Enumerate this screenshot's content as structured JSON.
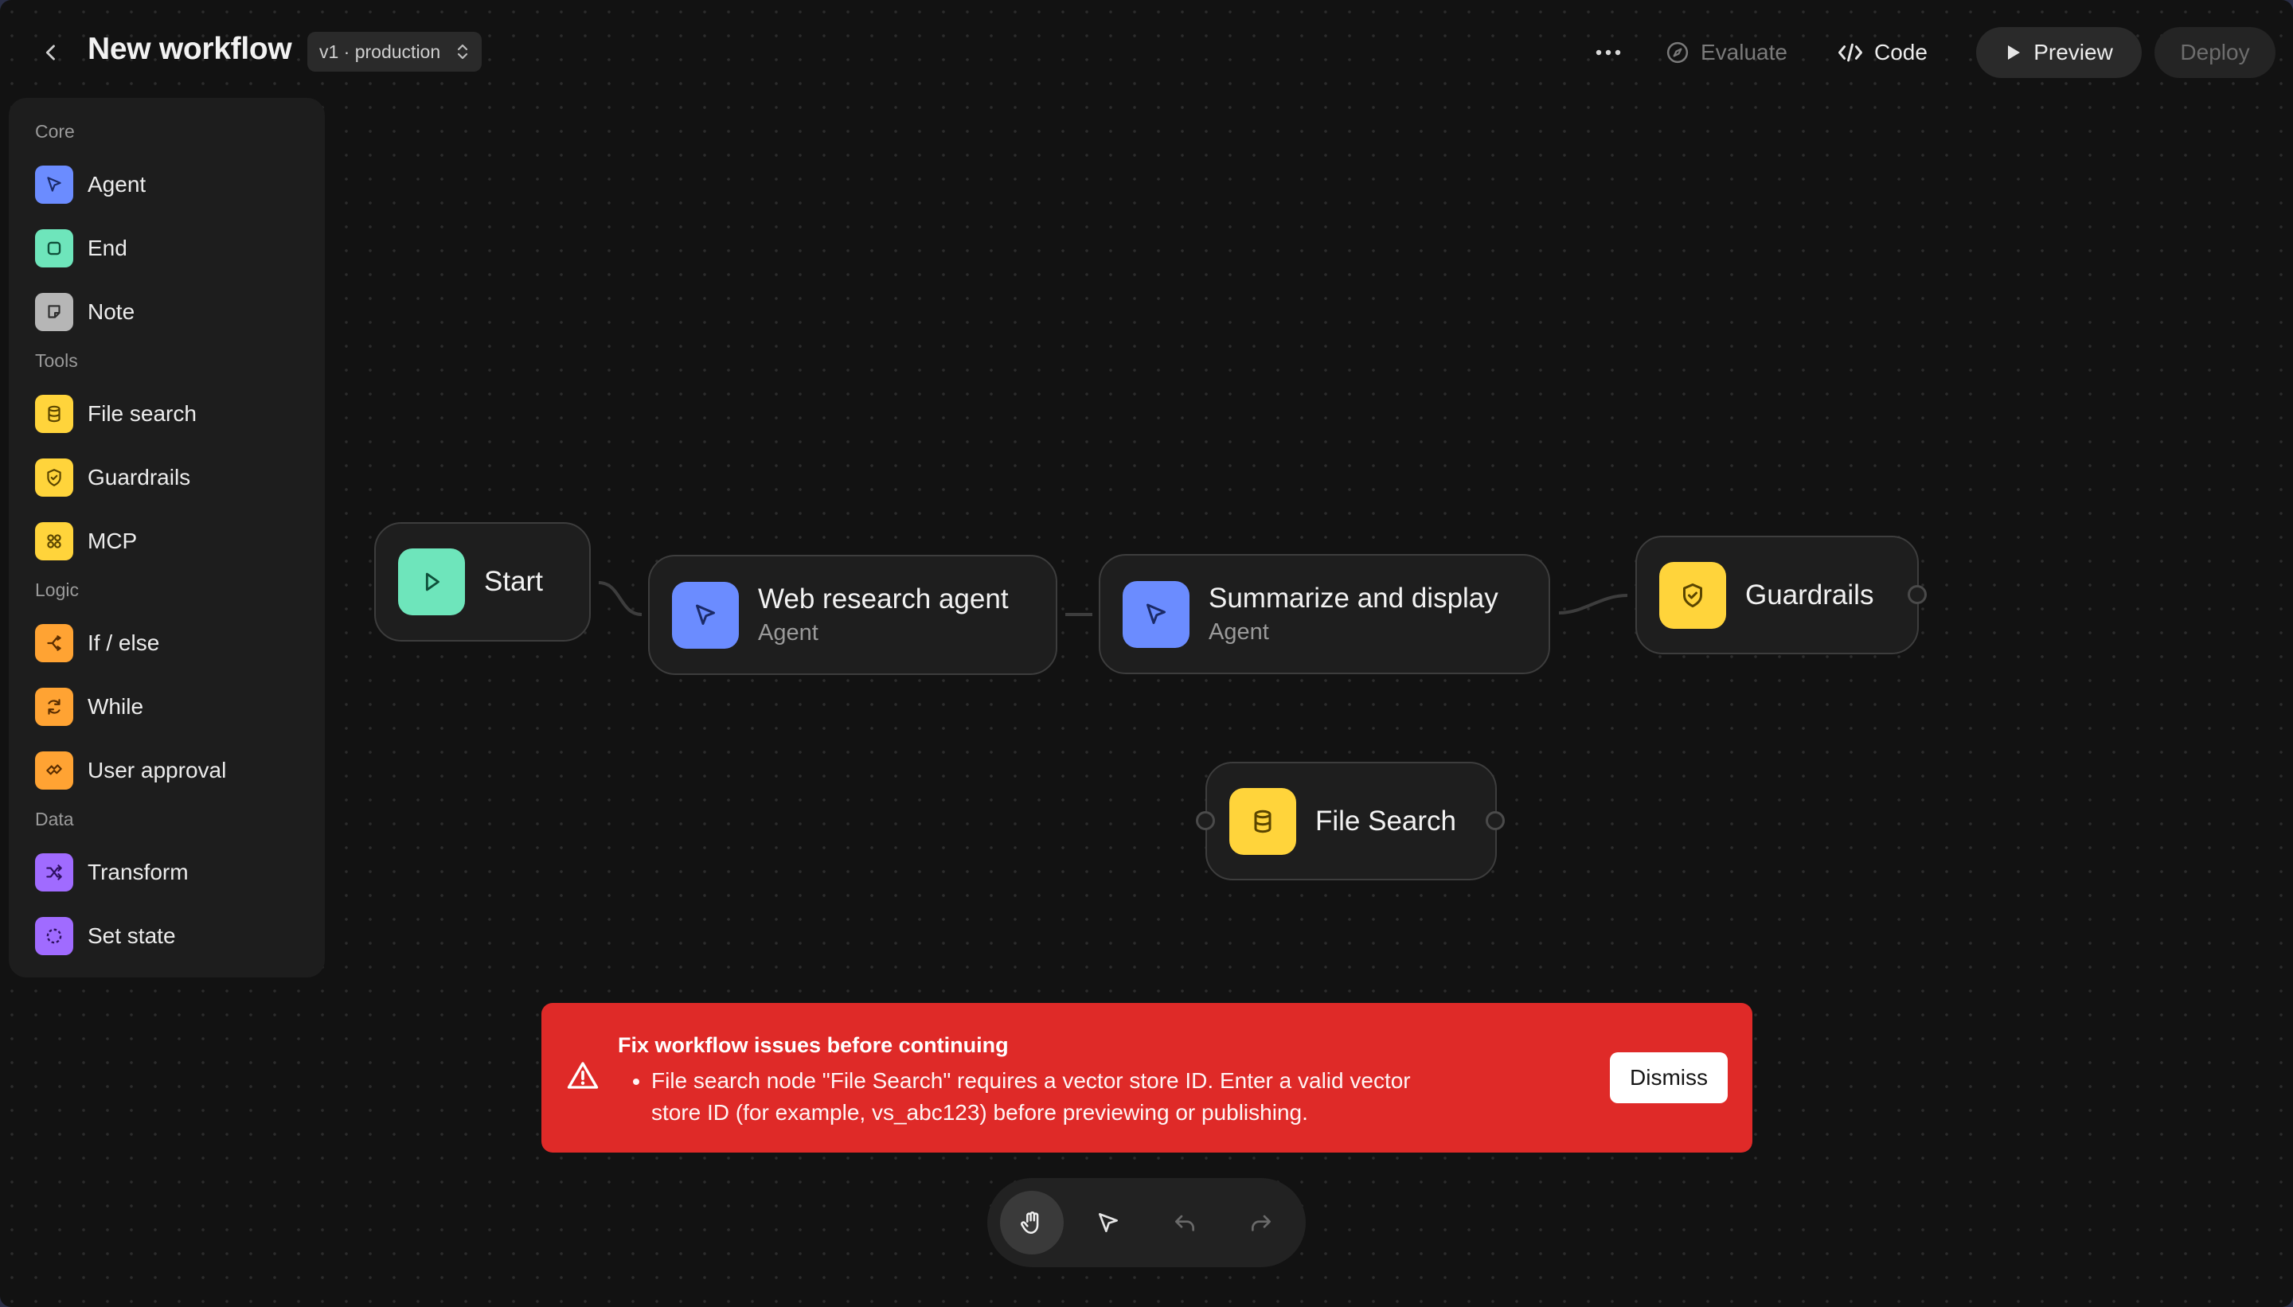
{
  "header": {
    "title": "New workflow",
    "version_label": "v1 · production",
    "more_icon": "ellipsis-icon",
    "evaluate_label": "Evaluate",
    "code_label": "Code",
    "preview_label": "Preview",
    "deploy_label": "Deploy"
  },
  "sidebar": {
    "sections": [
      {
        "label": "Core",
        "items": [
          {
            "label": "Agent",
            "icon": "agent-icon",
            "color": "#6b8cff"
          },
          {
            "label": "End",
            "icon": "end-icon",
            "color": "#6ee5bb"
          },
          {
            "label": "Note",
            "icon": "note-icon",
            "color": "#b6b6b6"
          }
        ]
      },
      {
        "label": "Tools",
        "items": [
          {
            "label": "File search",
            "icon": "file-search-icon",
            "color": "#ffd43b"
          },
          {
            "label": "Guardrails",
            "icon": "guardrails-icon",
            "color": "#ffd43b"
          },
          {
            "label": "MCP",
            "icon": "mcp-icon",
            "color": "#ffd43b"
          }
        ]
      },
      {
        "label": "Logic",
        "items": [
          {
            "label": "If / else",
            "icon": "if-else-icon",
            "color": "#ffa333"
          },
          {
            "label": "While",
            "icon": "while-icon",
            "color": "#ffa333"
          },
          {
            "label": "User approval",
            "icon": "user-approval-icon",
            "color": "#ffa333"
          }
        ]
      },
      {
        "label": "Data",
        "items": [
          {
            "label": "Transform",
            "icon": "transform-icon",
            "color": "#a06bff"
          },
          {
            "label": "Set state",
            "icon": "set-state-icon",
            "color": "#a06bff"
          }
        ]
      }
    ]
  },
  "canvas": {
    "nodes": [
      {
        "title": "Start",
        "icon": "play-icon",
        "color": "#6ee5bb"
      },
      {
        "title": "Web research agent",
        "subtitle": "Agent",
        "icon": "agent-icon",
        "color": "#6b8cff"
      },
      {
        "title": "Summarize and display",
        "subtitle": "Agent",
        "icon": "agent-icon",
        "color": "#6b8cff"
      },
      {
        "title": "Guardrails",
        "icon": "guardrails-icon",
        "color": "#ffd43b"
      },
      {
        "title": "File Search",
        "icon": "file-search-icon",
        "color": "#ffd43b"
      }
    ]
  },
  "alert": {
    "title": "Fix workflow issues before continuing",
    "messages": [
      "File search node \"File Search\" requires a vector store ID. Enter a valid vector store ID (for example, vs_abc123) before previewing or publishing."
    ],
    "dismiss_label": "Dismiss",
    "color": "#df2a28"
  },
  "toolbar": {
    "tools": [
      {
        "icon": "hand-icon",
        "active": true
      },
      {
        "icon": "pointer-icon",
        "active": false
      },
      {
        "icon": "undo-icon",
        "active": false
      },
      {
        "icon": "redo-icon",
        "active": false
      }
    ]
  }
}
